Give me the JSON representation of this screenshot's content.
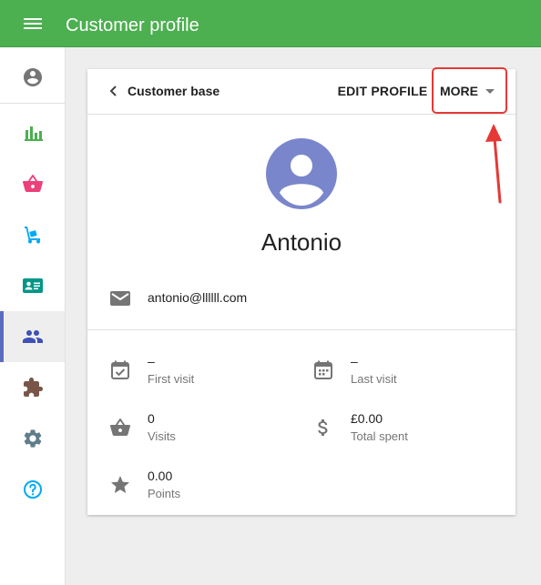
{
  "appbar": {
    "title": "Customer profile",
    "menu_icon": "menu-icon"
  },
  "sidebar": {
    "items": [
      {
        "name": "account",
        "icon": "account-circle-icon",
        "active": false
      },
      {
        "name": "reports",
        "icon": "bar-chart-icon",
        "active": false
      },
      {
        "name": "sales",
        "icon": "basket-icon",
        "active": false
      },
      {
        "name": "inventory",
        "icon": "dolly-icon",
        "active": false
      },
      {
        "name": "employees",
        "icon": "badge-icon",
        "active": false
      },
      {
        "name": "customers",
        "icon": "people-icon",
        "active": true
      },
      {
        "name": "integrations",
        "icon": "puzzle-icon",
        "active": false
      },
      {
        "name": "settings",
        "icon": "gear-icon",
        "active": false
      },
      {
        "name": "help",
        "icon": "help-icon",
        "active": false
      }
    ]
  },
  "card": {
    "back_label": "Customer base",
    "edit_label": "EDIT PROFILE",
    "more_label": "MORE",
    "customer_name": "Antonio",
    "email": "antonio@llllll.com",
    "stats": {
      "first_visit": {
        "value": "–",
        "label": "First visit"
      },
      "last_visit": {
        "value": "–",
        "label": "Last visit"
      },
      "visits": {
        "value": "0",
        "label": "Visits"
      },
      "total_spent": {
        "value": "£0.00",
        "label": "Total spent"
      },
      "points": {
        "value": "0.00",
        "label": "Points"
      }
    }
  },
  "colors": {
    "appbar": "#4caf50",
    "avatar": "#7986cb",
    "active_indicator": "#5c6bc0",
    "annotation": "#e53935"
  }
}
